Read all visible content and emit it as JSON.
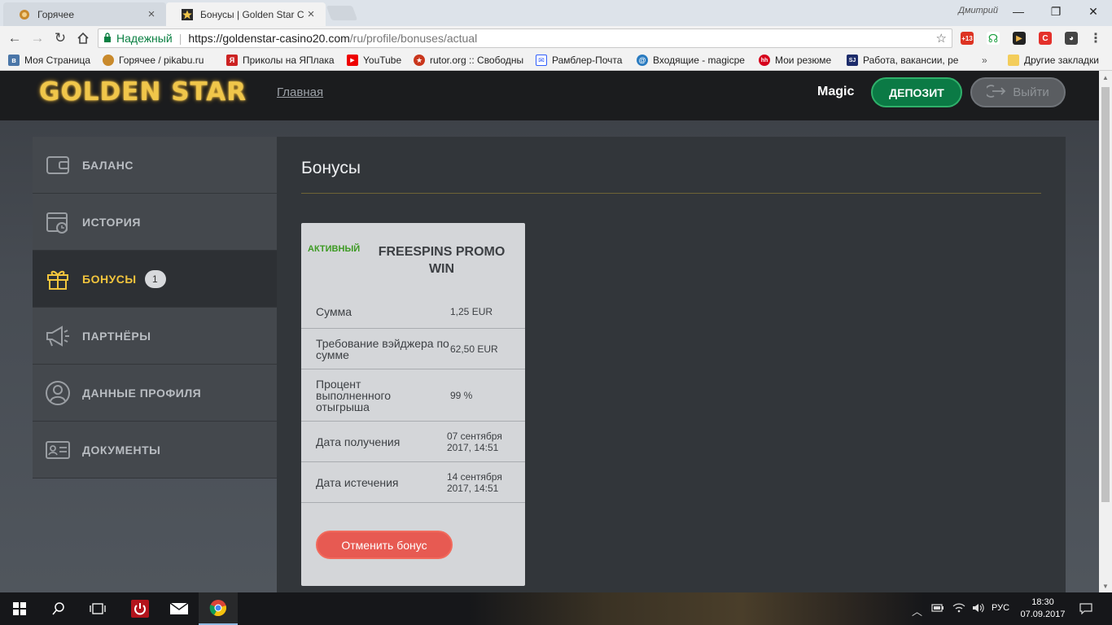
{
  "browser": {
    "tabs": [
      {
        "title": "Горячее",
        "active": false
      },
      {
        "title": "Бонусы | Golden Star Cas",
        "active": true
      }
    ],
    "window_user": "Дмитрий",
    "security_label": "Надежный",
    "url_host": "https://goldenstar-casino20.com",
    "url_path": "/ru/profile/bonuses/actual",
    "extension_badge": "+13",
    "bookmarks": [
      {
        "label": "Моя Страница",
        "icon": "vk-icon",
        "color": "#4a76a8"
      },
      {
        "label": "Горячее / pikabu.ru",
        "icon": "pikabu-icon",
        "color": "#c98a2c"
      },
      {
        "label": "Приколы на ЯПлака",
        "icon": "yaplakal-icon",
        "color": "#c22"
      },
      {
        "label": "YouTube",
        "icon": "youtube-icon",
        "color": "#e00"
      },
      {
        "label": "rutor.org :: Свободны",
        "icon": "rutor-icon",
        "color": "#c9361c"
      },
      {
        "label": "Рамблер-Почта",
        "icon": "rambler-mail-icon",
        "color": "#315efb"
      },
      {
        "label": "Входящие - magicpe",
        "icon": "mail-at-icon",
        "color": "#2a7bc0"
      },
      {
        "label": "Мои резюме",
        "icon": "hh-icon",
        "color": "#d6001c"
      },
      {
        "label": "Работа, вакансии, ре",
        "icon": "sj-icon",
        "color": "#1d2c6b"
      }
    ],
    "bookmarks_overflow": "»",
    "other_bookmarks": "Другие закладки"
  },
  "site": {
    "logo": "GOLDEN STAR",
    "nav_home": "Главная",
    "username": "Magic",
    "deposit_label": "ДЕПОЗИТ",
    "logout_label": "Выйти"
  },
  "sidebar": {
    "items": [
      {
        "label": "БАЛАНС",
        "icon": "wallet-icon",
        "active": false
      },
      {
        "label": "ИСТОРИЯ",
        "icon": "calendar-clock-icon",
        "active": false
      },
      {
        "label": "БОНУСЫ",
        "icon": "gift-icon",
        "active": true,
        "badge": "1"
      },
      {
        "label": "ПАРТНЁРЫ",
        "icon": "megaphone-icon",
        "active": false
      },
      {
        "label": "ДАННЫЕ ПРОФИЛЯ",
        "icon": "user-circle-icon",
        "active": false
      },
      {
        "label": "ДОКУМЕНТЫ",
        "icon": "id-card-icon",
        "active": false
      }
    ]
  },
  "content": {
    "title": "Бонусы",
    "bonus": {
      "status": "АКТИВНЫЙ",
      "name": "FREESPINS PROMO WIN",
      "rows": [
        {
          "label": "Сумма",
          "value": "1,25 EUR"
        },
        {
          "label": "Требование вэйджера по сумме",
          "value": "62,50 EUR"
        },
        {
          "label": "Процент выполненного отыгрыша",
          "value": "99 %"
        },
        {
          "label": "Дата получения",
          "value": "07 сентября 2017, 14:51"
        },
        {
          "label": "Дата истечения",
          "value": "14 сентября 2017, 14:51"
        }
      ],
      "cancel_label": "Отменить бонус"
    }
  },
  "taskbar": {
    "language": "РУС",
    "time": "18:30",
    "date": "07.09.2017"
  },
  "colors": {
    "accent_gold": "#f2c53d",
    "deposit_green": "#0b7a45",
    "active_status": "#3c9a22",
    "cancel_red": "#e75a52"
  }
}
